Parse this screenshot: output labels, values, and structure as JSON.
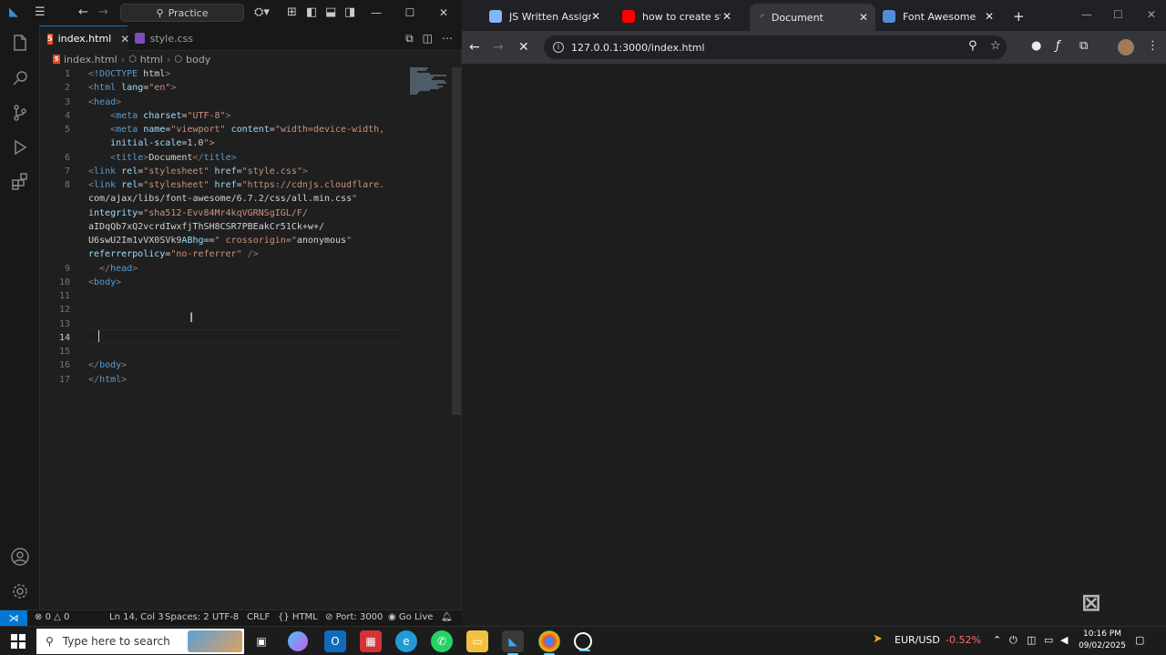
{
  "vscode": {
    "title_search": "Practice",
    "tabs": [
      {
        "label": "index.html",
        "active": true
      },
      {
        "label": "style.css",
        "active": false
      }
    ],
    "breadcrumb": [
      "index.html",
      "html",
      "body"
    ],
    "code_lines": [
      {
        "n": "1",
        "text": "<!DOCTYPE html>"
      },
      {
        "n": "2",
        "text": "<html lang=\"en\">"
      },
      {
        "n": "3",
        "text": "<head>"
      },
      {
        "n": "4",
        "text": "    <meta charset=\"UTF-8\">"
      },
      {
        "n": "5",
        "text": "    <meta name=\"viewport\" content=\"width=device-width,"
      },
      {
        "n": "",
        "text": "    initial-scale=1.0\">"
      },
      {
        "n": "6",
        "text": "    <title>Document</title>"
      },
      {
        "n": "7",
        "text": "<link rel=\"stylesheet\" href=\"style.css\">"
      },
      {
        "n": "8",
        "text": "<link rel=\"stylesheet\" href=\"https://cdnjs.cloudflare."
      },
      {
        "n": "",
        "text": "com/ajax/libs/font-awesome/6.7.2/css/all.min.css\""
      },
      {
        "n": "",
        "text": "integrity=\"sha512-Evv84Mr4kqVGRNSgIGL/F/"
      },
      {
        "n": "",
        "text": "aIDqQb7xQ2vcrdIwxfjThSH8CSR7PBEakCr51Ck+w+/"
      },
      {
        "n": "",
        "text": "U6swU2Im1vVX0SVk9ABhg==\" crossorigin=\"anonymous\""
      },
      {
        "n": "",
        "text": "referrerpolicy=\"no-referrer\" />"
      },
      {
        "n": "9",
        "text": "  </head>"
      },
      {
        "n": "10",
        "text": "<body>"
      },
      {
        "n": "11",
        "text": ""
      },
      {
        "n": "12",
        "text": ""
      },
      {
        "n": "13",
        "text": ""
      },
      {
        "n": "14",
        "text": ""
      },
      {
        "n": "15",
        "text": ""
      },
      {
        "n": "16",
        "text": "</body>"
      },
      {
        "n": "17",
        "text": "</html>"
      }
    ],
    "status": {
      "errors": "0",
      "warnings": "0",
      "position": "Ln 14, Col 3",
      "spaces": "Spaces: 2",
      "encoding": "UTF-8",
      "eol": "CRLF",
      "language": "HTML",
      "port": "Port: 3000",
      "golive": "Go Live"
    }
  },
  "browser": {
    "tabs": [
      {
        "label": "JS Written Assignme",
        "favicon_color": "#8ab4f8"
      },
      {
        "label": "how to create star b",
        "favicon_color": "#ff0000"
      },
      {
        "label": "Document",
        "favicon_color": "#35363a",
        "active": true
      },
      {
        "label": "Font Awesome",
        "favicon_color": "#538dd7"
      }
    ],
    "url": "127.0.0.1:3000/index.html"
  },
  "taskbar": {
    "search_placeholder": "Type here to search",
    "ticker_symbol": "EUR/USD",
    "ticker_change": "-0.52%",
    "time": "10:16 PM",
    "date": "09/02/2025"
  },
  "colors": {
    "accent": "#0078d4",
    "ticker_negative": "#ff6b6b"
  }
}
